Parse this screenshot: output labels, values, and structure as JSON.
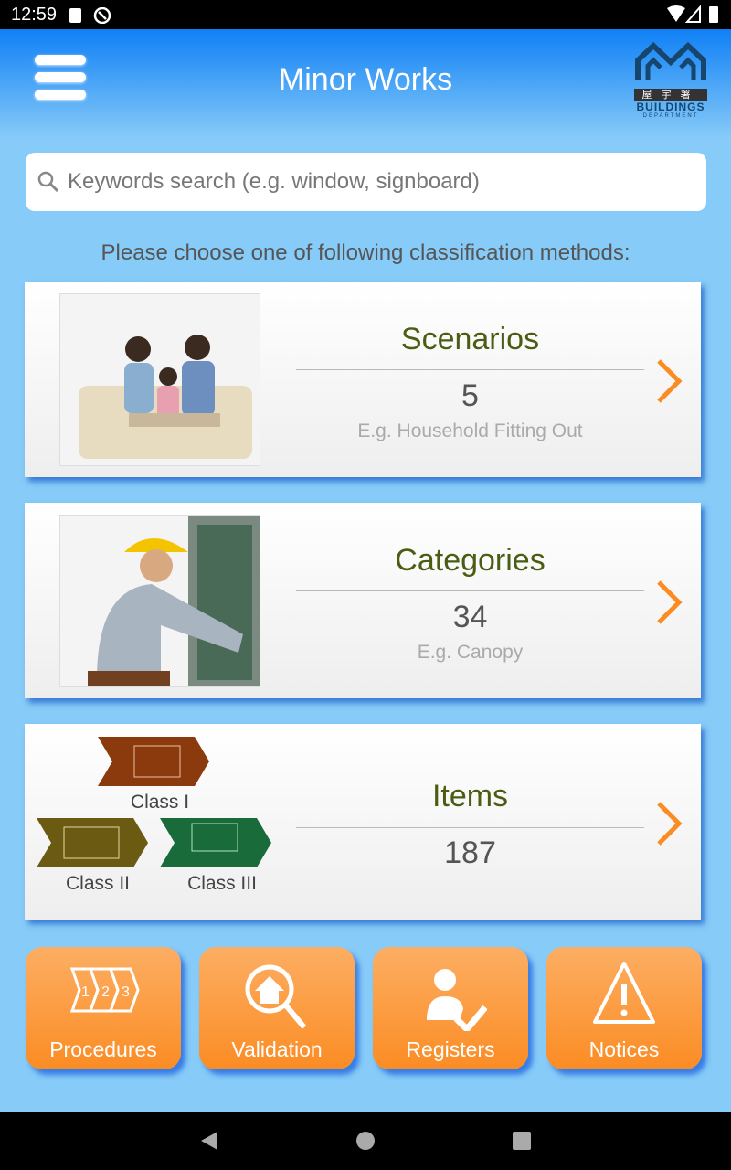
{
  "status_bar": {
    "time": "12:59"
  },
  "header": {
    "title": "Minor Works",
    "logo": {
      "chinese": "屋宇署",
      "english": "BUILDINGS",
      "english_sub": "DEPARTMENT"
    }
  },
  "search": {
    "placeholder": "Keywords search (e.g. window, signboard)",
    "value": ""
  },
  "subtitle": "Please choose one of following classification methods:",
  "cards": [
    {
      "title": "Scenarios",
      "count": "5",
      "example": "E.g. Household Fitting Out"
    },
    {
      "title": "Categories",
      "count": "34",
      "example": "E.g. Canopy"
    },
    {
      "title": "Items",
      "count": "187",
      "classes": [
        "Class I",
        "Class II",
        "Class III"
      ],
      "class_colors": [
        "#8b3a0e",
        "#6b5a12",
        "#1a6b3a"
      ]
    }
  ],
  "buttons": [
    {
      "label": "Procedures",
      "icon": "steps-123-icon"
    },
    {
      "label": "Validation",
      "icon": "house-search-icon"
    },
    {
      "label": "Registers",
      "icon": "person-check-icon"
    },
    {
      "label": "Notices",
      "icon": "warning-icon"
    }
  ],
  "colors": {
    "accent": "#fb8c24",
    "title_text": "#4a5d12",
    "header": "#0f80f5"
  }
}
